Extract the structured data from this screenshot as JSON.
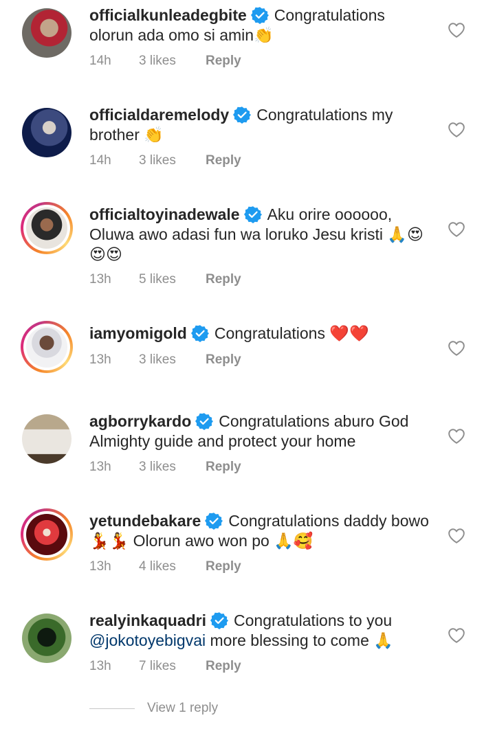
{
  "comments": [
    {
      "username": "officialkunleadegbite",
      "text": "Congratulations olorun ada omo si amin👏",
      "time": "14h",
      "likes": "3 likes",
      "reply": "Reply",
      "story_ring": false,
      "avatar_colors": [
        "#6e6a64",
        "#c2a48a",
        "#b22434"
      ]
    },
    {
      "username": "officialdaremelody",
      "text": "Congratulations my brother 👏",
      "time": "14h",
      "likes": "3 likes",
      "reply": "Reply",
      "story_ring": false,
      "avatar_colors": [
        "#0e1c4a",
        "#3c4a7e",
        "#d8d0c8"
      ]
    },
    {
      "username": "officialtoyinadewale",
      "text": "Aku orire oooooo, Oluwa awo adasi fun wa  loruko Jesu kristi 🙏😍😍😍",
      "time": "13h",
      "likes": "5 likes",
      "reply": "Reply",
      "story_ring": true,
      "avatar_colors": [
        "#2a2a2a",
        "#9a6a4e",
        "#e8e4de"
      ]
    },
    {
      "username": "iamyomigold",
      "text": "Congratulations ❤️❤️",
      "time": "13h",
      "likes": "3 likes",
      "reply": "Reply",
      "story_ring": true,
      "avatar_colors": [
        "#f2f2f4",
        "#6b4a3a",
        "#d9d9df"
      ]
    },
    {
      "username": "agborrykardo",
      "text": "Congratulations aburo God Almighty guide and protect your home",
      "time": "13h",
      "likes": "3 likes",
      "reply": "Reply",
      "story_ring": false,
      "avatar_colors": [
        "#b8a88c",
        "#eae6e0",
        "#4a3a2a"
      ]
    },
    {
      "username": "yetundebakare",
      "text": "Congratulations daddy bowo 💃💃 Olorun awo won po 🙏🥰",
      "time": "13h",
      "likes": "4 likes",
      "reply": "Reply",
      "story_ring": true,
      "avatar_colors": [
        "#5a0a0e",
        "#e03a3e",
        "#f0e0d0"
      ]
    },
    {
      "username": "realyinkaquadri",
      "text_before": "Congratulations to you ",
      "mention": "@jokotoyebigvai",
      "text_after": " more blessing to come 🙏",
      "time": "13h",
      "likes": "7 likes",
      "reply": "Reply",
      "story_ring": false,
      "avatar_colors": [
        "#3a6a2a",
        "#0e1a10",
        "#8aa870"
      ]
    }
  ],
  "view_replies": "View 1 reply",
  "colors": {
    "verified": "#1e9bf0",
    "mention": "#00376b",
    "meta": "#8e8e8e",
    "heart_outline": "#8e8e8e"
  }
}
